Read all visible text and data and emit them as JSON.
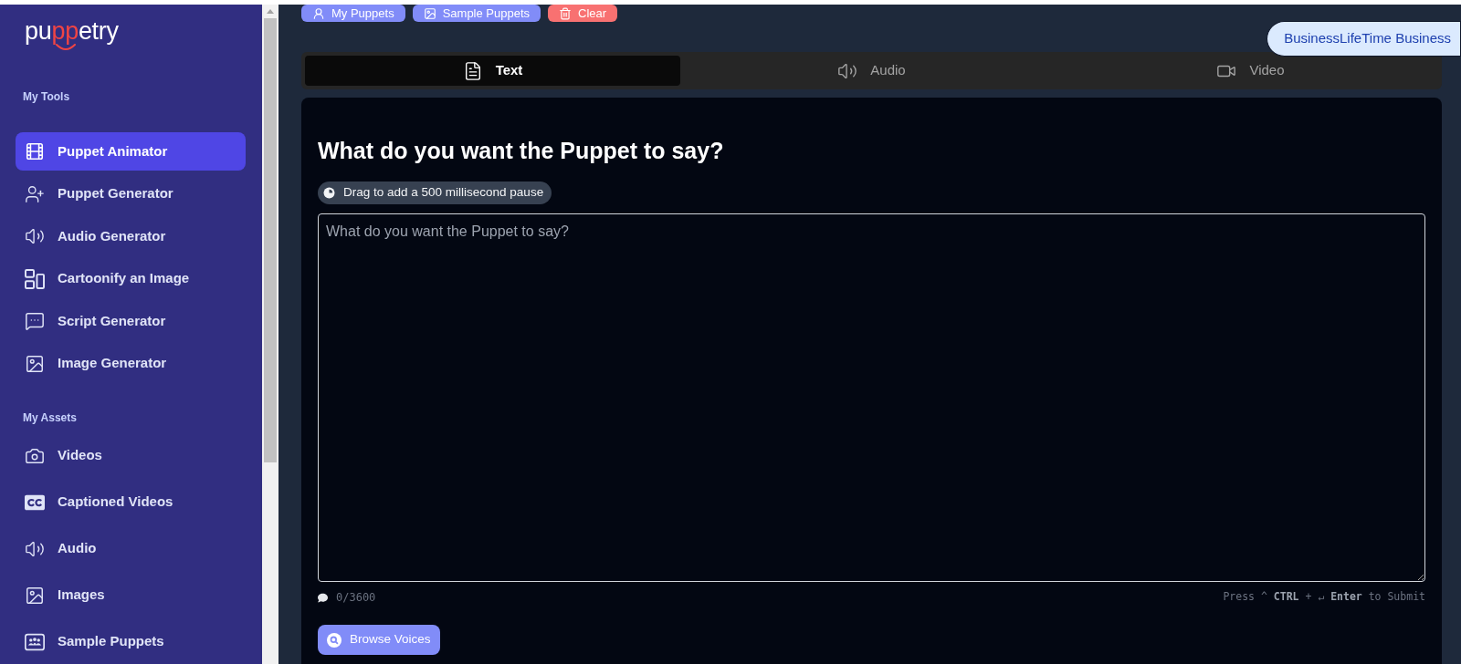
{
  "logo": {
    "parts": [
      {
        "text": "pu",
        "accent": false
      },
      {
        "text": "pp",
        "accent": true
      },
      {
        "text": "etry",
        "accent": false
      }
    ]
  },
  "sidebar": {
    "sections": [
      {
        "title": "My Tools",
        "items": [
          {
            "label": "Puppet Animator",
            "selected": true
          },
          {
            "label": "Puppet Generator",
            "selected": false
          },
          {
            "label": "Audio Generator",
            "selected": false
          },
          {
            "label": "Cartoonify an Image",
            "selected": false
          },
          {
            "label": "Script Generator",
            "selected": false
          },
          {
            "label": "Image Generator",
            "selected": false
          }
        ]
      },
      {
        "title": "My Assets",
        "items": [
          {
            "label": "Videos",
            "selected": false
          },
          {
            "label": "Captioned Videos",
            "selected": false
          },
          {
            "label": "Audio",
            "selected": false
          },
          {
            "label": "Images",
            "selected": false
          },
          {
            "label": "Sample Puppets",
            "selected": false
          }
        ]
      }
    ]
  },
  "toolbar": {
    "buttons": [
      {
        "label": "My Puppets",
        "kind": "primary"
      },
      {
        "label": "Sample Puppets",
        "kind": "primary"
      },
      {
        "label": "Clear",
        "kind": "danger"
      }
    ]
  },
  "plan_badge": "BusinessLifeTime Business",
  "tabs": [
    {
      "label": "Text",
      "selected": true
    },
    {
      "label": "Audio",
      "selected": false
    },
    {
      "label": "Video",
      "selected": false
    }
  ],
  "editor": {
    "heading": "What do you want the Puppet to say?",
    "pause_chip": "Drag to add a 500 millisecond pause",
    "text_field": {
      "placeholder": "What do you want the Puppet to say?"
    },
    "char_count": "0/3600",
    "submit_hint": "Press ^ **CTRL** + ↵ **Enter** to Submit",
    "browse_button": "Browse Voices"
  }
}
